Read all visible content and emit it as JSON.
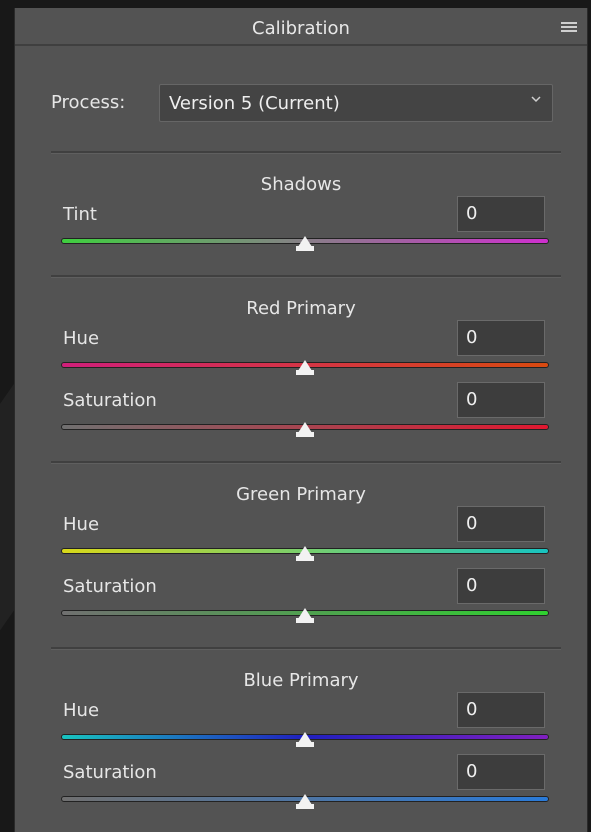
{
  "panel": {
    "title": "Calibration"
  },
  "process": {
    "label": "Process:",
    "value": "Version 5 (Current)"
  },
  "sections": [
    {
      "title": "Shadows",
      "rows": [
        {
          "label": "Tint",
          "value": "0",
          "level": 0.5,
          "gradient": [
            "#3fcf3f",
            "#cf2fcf"
          ]
        }
      ]
    },
    {
      "title": "Red Primary",
      "rows": [
        {
          "label": "Hue",
          "value": "0",
          "level": 0.5,
          "gradient": [
            "#d01f7a",
            "#d84a10"
          ]
        },
        {
          "label": "Saturation",
          "value": "0",
          "level": 0.5,
          "gradient": [
            "#707070",
            "#e01830"
          ]
        }
      ]
    },
    {
      "title": "Green Primary",
      "rows": [
        {
          "label": "Hue",
          "value": "0",
          "level": 0.5,
          "gradient": [
            "#d8d81a",
            "#18c4c0"
          ]
        },
        {
          "label": "Saturation",
          "value": "0",
          "level": 0.5,
          "gradient": [
            "#707070",
            "#30d030"
          ]
        }
      ]
    },
    {
      "title": "Blue Primary",
      "rows": [
        {
          "label": "Hue",
          "value": "0",
          "level": 0.5,
          "gradient": [
            "#18c4c0",
            "#2020c0",
            "#8020c0"
          ]
        },
        {
          "label": "Saturation",
          "value": "0",
          "level": 0.5,
          "gradient": [
            "#707070",
            "#2a7ad8"
          ]
        }
      ]
    }
  ]
}
